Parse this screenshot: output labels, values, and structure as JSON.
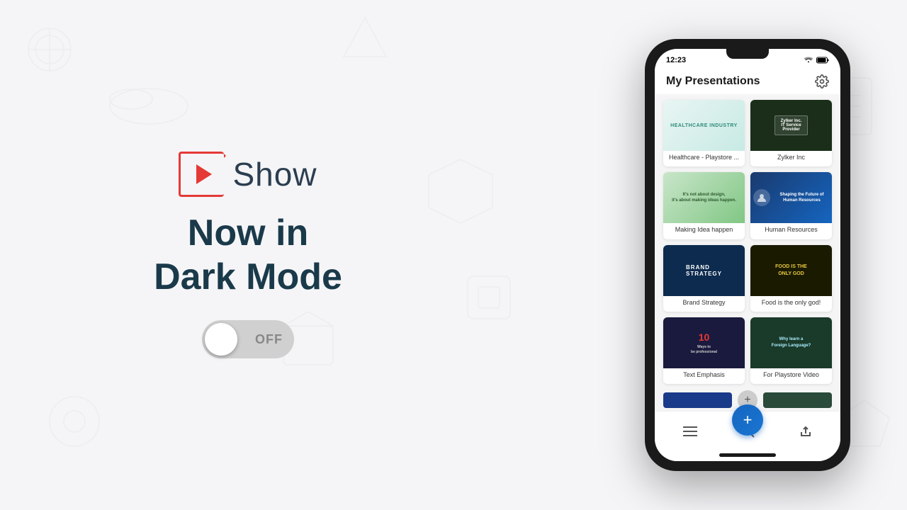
{
  "background": {
    "color": "#f5f5f7"
  },
  "left": {
    "logo": {
      "text": "Show"
    },
    "tagline_line1": "Now in",
    "tagline_line2": "Dark Mode",
    "toggle": {
      "state": "OFF",
      "label": "OFF"
    }
  },
  "phone": {
    "status_bar": {
      "time": "12:23"
    },
    "header": {
      "title": "My Presentations",
      "settings_icon": "gear"
    },
    "presentations": [
      {
        "id": "healthcare",
        "title": "Healthcare - Playstore ...",
        "thumb_text": "HEALTHCARE INDUSTRY",
        "thumb_style": "healthcare"
      },
      {
        "id": "zylker",
        "title": "Zylker Inc",
        "thumb_text": "Zylker Inc. IT Service Provider",
        "thumb_style": "zylker"
      },
      {
        "id": "idea",
        "title": "Making Idea happen",
        "thumb_text": "It's not about design, it's about making ideas happen.",
        "thumb_style": "idea"
      },
      {
        "id": "hr",
        "title": "Human Resources",
        "thumb_text": "Shaping the Future of Human Resources",
        "thumb_style": "hr"
      },
      {
        "id": "brand",
        "title": "Brand Strategy",
        "thumb_text": "BRAND STRATEGY",
        "thumb_style": "brand"
      },
      {
        "id": "food",
        "title": "Food is the only god!",
        "thumb_text": "FOOD IS THE ONLY GOD",
        "thumb_style": "food"
      },
      {
        "id": "text",
        "title": "Text Emphasis",
        "thumb_text": "10 Ways to be professional",
        "thumb_num": "10",
        "thumb_style": "text"
      },
      {
        "id": "playstore",
        "title": "For Playstore Video",
        "thumb_text": "Why learn a Foreign Language?",
        "thumb_style": "playstore"
      }
    ],
    "bottom_bar": {
      "menu_icon": "menu",
      "search_icon": "search",
      "upload_icon": "upload",
      "fab_icon": "plus"
    }
  }
}
